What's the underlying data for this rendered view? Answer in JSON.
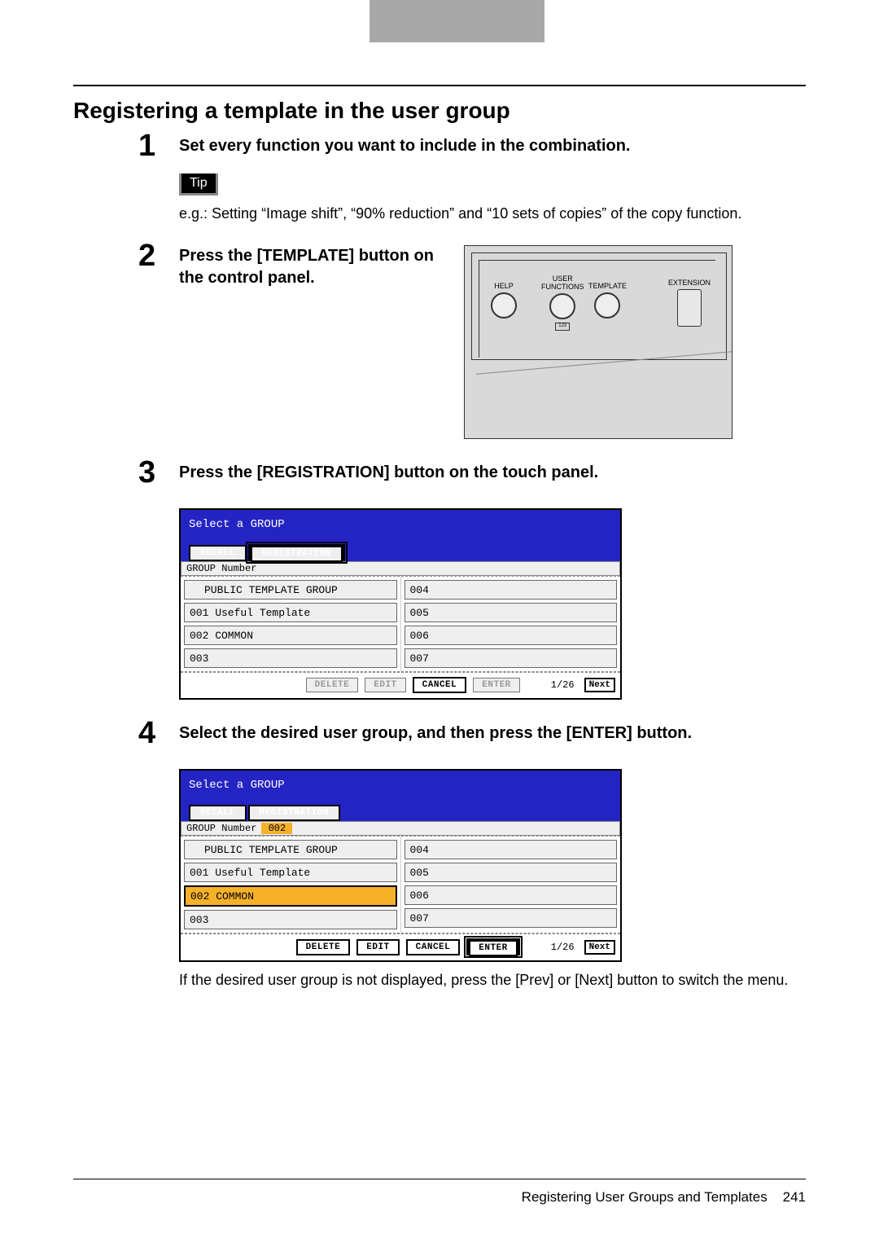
{
  "doc": {
    "title": "Registering a template in the user group"
  },
  "tip_label": "Tip",
  "steps": {
    "s1": {
      "num": "1",
      "text": "Set every function you want to include in the combination.",
      "tip_text": "e.g.: Setting “Image shift”, “90% reduction” and “10 sets of copies” of the copy function."
    },
    "s2": {
      "num": "2",
      "text": "Press the [TEMPLATE] button on the control panel."
    },
    "s3": {
      "num": "3",
      "text": "Press the [REGISTRATION] button on the touch panel."
    },
    "s4": {
      "num": "4",
      "text": "Select the desired user group, and then press the [ENTER] button.",
      "note": "If the desired user group is not displayed, press the [Prev] or [Next] button to switch the menu."
    }
  },
  "panel": {
    "help": "HELP",
    "user_functions": "USER\nFUNCTIONS",
    "template": "TEMPLATE",
    "extension": "EXTENSION"
  },
  "touch": {
    "header": "Select a GROUP",
    "tab_recall": "RECALL",
    "tab_registration": "REGISTRATION",
    "group_number_label": "GROUP Number",
    "group_number_value": "002",
    "left_cells": [
      "PUBLIC TEMPLATE GROUP",
      "001 Useful Template",
      "002 COMMON",
      "003"
    ],
    "right_cells": [
      "004",
      "005",
      "006",
      "007"
    ],
    "btn_delete": "DELETE",
    "btn_edit": "EDIT",
    "btn_cancel": "CANCEL",
    "btn_enter": "ENTER",
    "page": "1/26",
    "btn_next": "Next"
  },
  "footer": {
    "text": "Registering User Groups and Templates    241"
  }
}
